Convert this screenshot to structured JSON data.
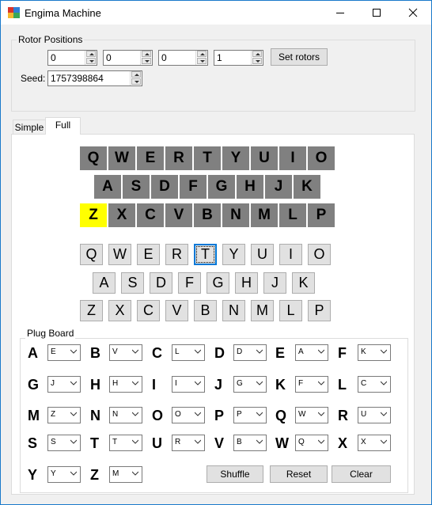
{
  "window": {
    "title": "Engima Machine",
    "icon": "app-icon"
  },
  "rotor_positions": {
    "group_title": "Rotor Positions",
    "values": [
      "0",
      "0",
      "0",
      "1"
    ],
    "set_label": "Set rotors",
    "seed_label": "Seed:",
    "seed_value": "1757398864"
  },
  "tabs": [
    {
      "label": "Simple",
      "active": false
    },
    {
      "label": "Full",
      "active": true
    }
  ],
  "lampboard": {
    "rows": [
      [
        "Q",
        "W",
        "E",
        "R",
        "T",
        "Y",
        "U",
        "I",
        "O"
      ],
      [
        "A",
        "S",
        "D",
        "F",
        "G",
        "H",
        "J",
        "K"
      ],
      [
        "Z",
        "X",
        "C",
        "V",
        "B",
        "N",
        "M",
        "L",
        "P"
      ]
    ],
    "lit": "Z",
    "lit_color": "#ffff00",
    "off_color": "#808080"
  },
  "keyboard": {
    "rows": [
      [
        "Q",
        "W",
        "E",
        "R",
        "T",
        "Y",
        "U",
        "I",
        "O"
      ],
      [
        "A",
        "S",
        "D",
        "F",
        "G",
        "H",
        "J",
        "K"
      ],
      [
        "Z",
        "X",
        "C",
        "V",
        "B",
        "N",
        "M",
        "L",
        "P"
      ]
    ],
    "focused": "T"
  },
  "plugboard": {
    "group_title": "Plug Board",
    "rows": [
      [
        {
          "letter": "A",
          "value": "E"
        },
        {
          "letter": "B",
          "value": "V"
        },
        {
          "letter": "C",
          "value": "L"
        },
        {
          "letter": "D",
          "value": "D"
        },
        {
          "letter": "E",
          "value": "A"
        },
        {
          "letter": "F",
          "value": "K"
        }
      ],
      [
        {
          "letter": "G",
          "value": "J"
        },
        {
          "letter": "H",
          "value": "H"
        },
        {
          "letter": "I",
          "value": "I"
        },
        {
          "letter": "J",
          "value": "G"
        },
        {
          "letter": "K",
          "value": "F"
        },
        {
          "letter": "L",
          "value": "C"
        }
      ],
      [
        {
          "letter": "M",
          "value": "Z"
        },
        {
          "letter": "N",
          "value": "N"
        },
        {
          "letter": "O",
          "value": "O"
        },
        {
          "letter": "P",
          "value": "P"
        },
        {
          "letter": "Q",
          "value": "W"
        },
        {
          "letter": "R",
          "value": "U"
        }
      ],
      [
        {
          "letter": "S",
          "value": "S"
        },
        {
          "letter": "T",
          "value": "T"
        },
        {
          "letter": "U",
          "value": "R"
        },
        {
          "letter": "V",
          "value": "B"
        },
        {
          "letter": "W",
          "value": "Q"
        },
        {
          "letter": "X",
          "value": "X"
        }
      ],
      [
        {
          "letter": "Y",
          "value": "Y"
        },
        {
          "letter": "Z",
          "value": "M"
        }
      ]
    ],
    "shuffle_label": "Shuffle",
    "reset_label": "Reset",
    "clear_label": "Clear"
  }
}
